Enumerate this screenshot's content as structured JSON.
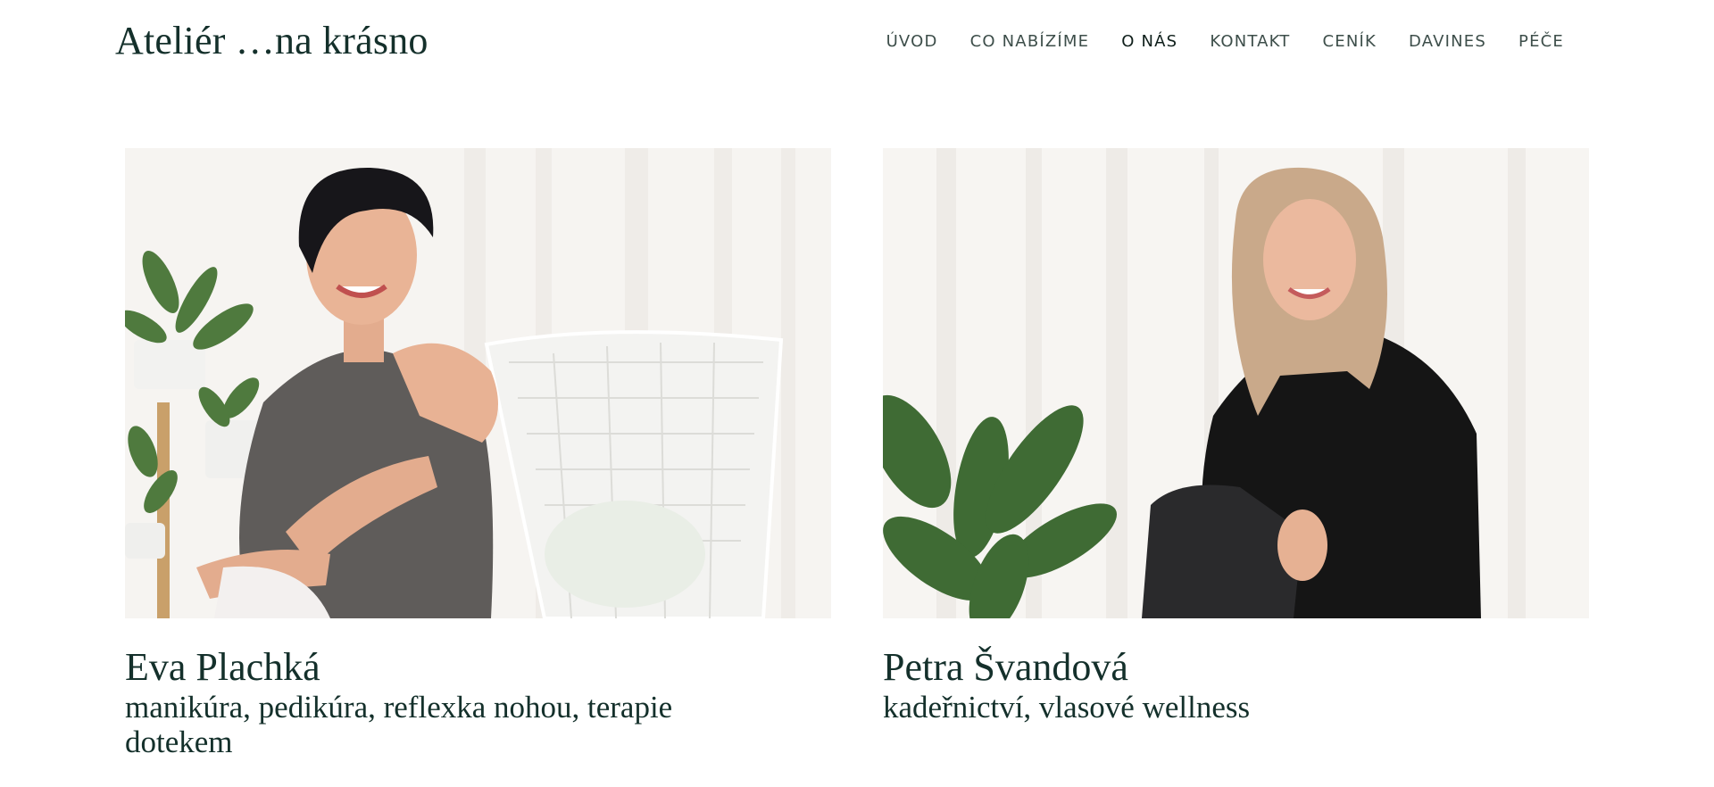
{
  "header": {
    "site_title": "Ateliér …na krásno",
    "nav": [
      {
        "label": "ÚVOD"
      },
      {
        "label": "CO NABÍZÍME"
      },
      {
        "label": "O NÁS",
        "active": true
      },
      {
        "label": "KONTAKT"
      },
      {
        "label": "CENÍK"
      },
      {
        "label": "DAVINES"
      },
      {
        "label": "PÉČE"
      }
    ]
  },
  "team": [
    {
      "name": "Eva Plachká",
      "role": "manikúra, pedikúra, reflexka nohou, terapie dotekem"
    },
    {
      "name": "Petra Švandová",
      "role": "kadeřnictví, vlasové wellness"
    }
  ],
  "colors": {
    "text": "#14302b",
    "nav_text": "#3d4e4a",
    "nav_active": "#0f1f1b",
    "background": "#ffffff"
  }
}
